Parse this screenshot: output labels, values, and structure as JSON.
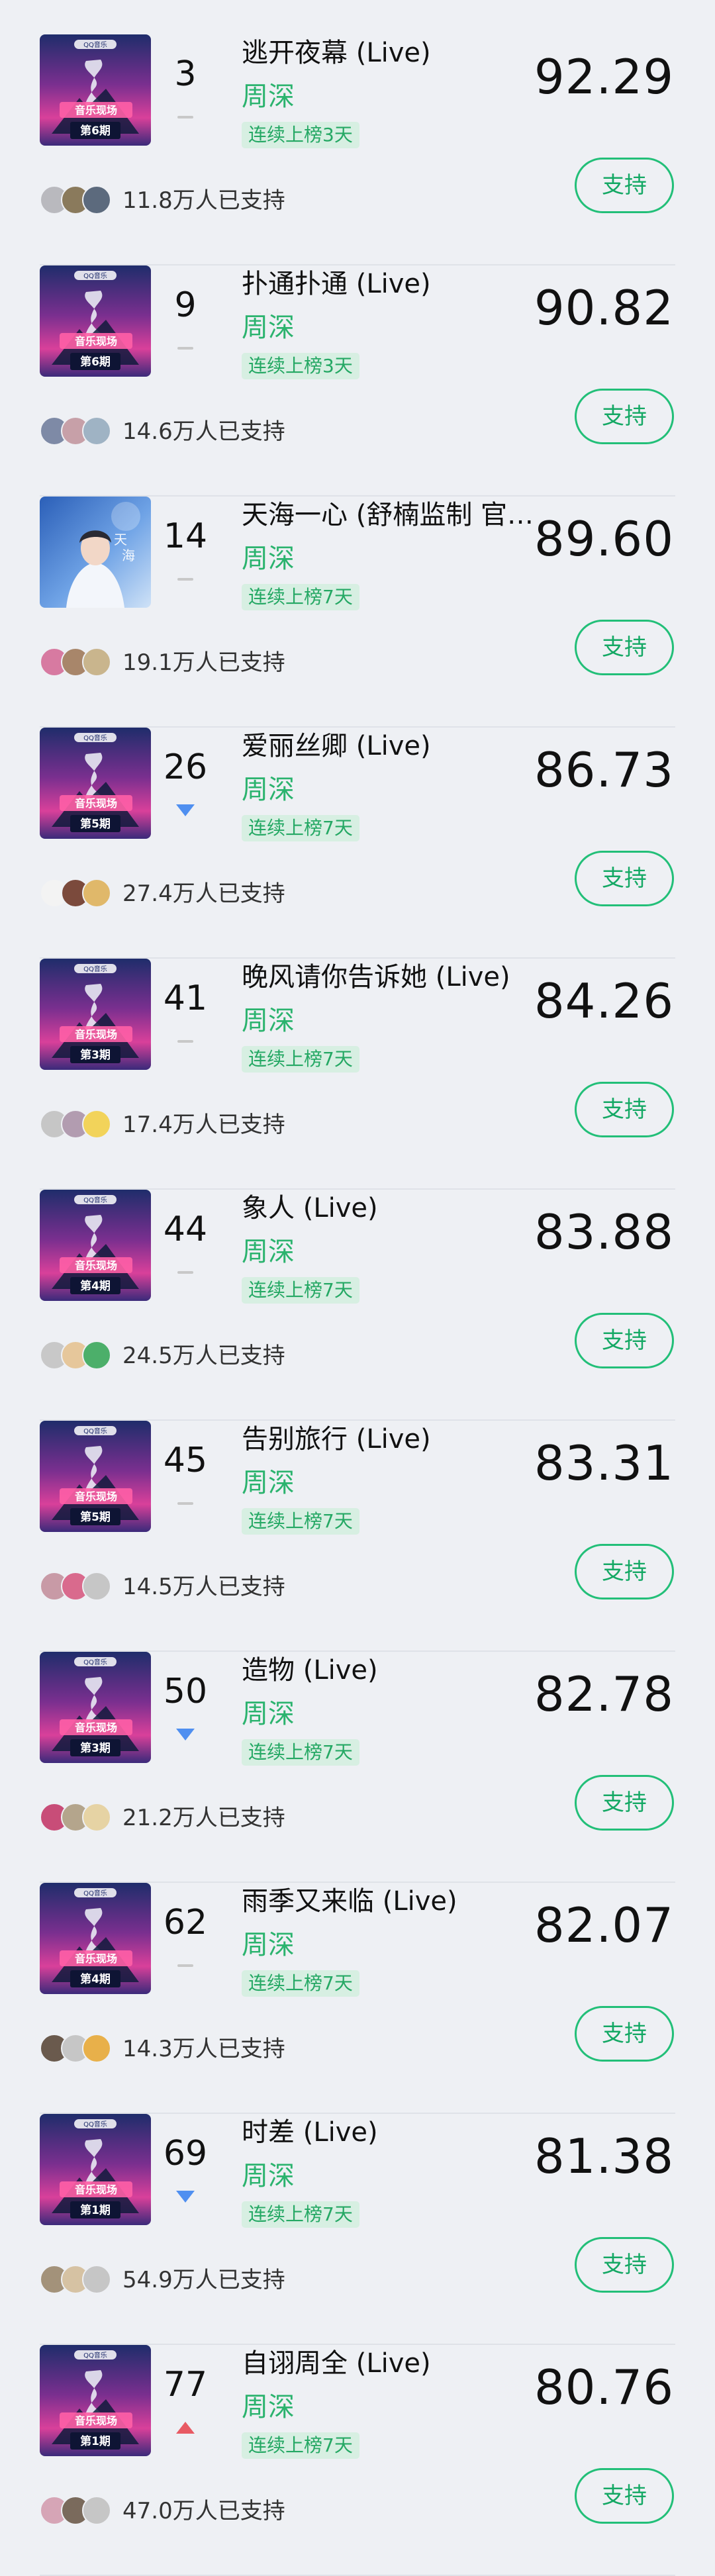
{
  "support_label": "支持",
  "colors": {
    "accent_green": "#22bf78",
    "artist_green": "#2bb36e",
    "badge_bg": "#d7efe2",
    "trend_up": "#e85a63",
    "trend_down": "#4f8ff0",
    "trend_flat": "#c8c8c8"
  },
  "items": [
    {
      "rank": "3",
      "trend": "flat",
      "title": "逃开夜幕 (Live)",
      "artist": "周深",
      "badge": "连续上榜3天",
      "score": "92.29",
      "supporters": "11.8万人已支持",
      "cover_icon": "album-cover-show-ep6",
      "cover_label": "第6期",
      "cover_style": "show"
    },
    {
      "rank": "9",
      "trend": "flat",
      "title": "扑通扑通 (Live)",
      "artist": "周深",
      "badge": "连续上榜3天",
      "score": "90.82",
      "supporters": "14.6万人已支持",
      "cover_icon": "album-cover-show-ep6",
      "cover_label": "第6期",
      "cover_style": "show"
    },
    {
      "rank": "14",
      "trend": "flat",
      "title": "天海一心 (舒楠监制 官方版)",
      "artist": "周深",
      "badge": "连续上榜7天",
      "score": "89.60",
      "supporters": "19.1万人已支持",
      "cover_icon": "album-cover-portrait",
      "cover_label": "",
      "cover_style": "portrait"
    },
    {
      "rank": "26",
      "trend": "down",
      "title": "爱丽丝卿 (Live)",
      "artist": "周深",
      "badge": "连续上榜7天",
      "score": "86.73",
      "supporters": "27.4万人已支持",
      "cover_icon": "album-cover-show-ep5",
      "cover_label": "第5期",
      "cover_style": "show"
    },
    {
      "rank": "41",
      "trend": "flat",
      "title": "晚风请你告诉她 (Live)",
      "artist": "周深",
      "badge": "连续上榜7天",
      "score": "84.26",
      "supporters": "17.4万人已支持",
      "cover_icon": "album-cover-show-ep3",
      "cover_label": "第3期",
      "cover_style": "show"
    },
    {
      "rank": "44",
      "trend": "flat",
      "title": "象人 (Live)",
      "artist": "周深",
      "badge": "连续上榜7天",
      "score": "83.88",
      "supporters": "24.5万人已支持",
      "cover_icon": "album-cover-show-ep4",
      "cover_label": "第4期",
      "cover_style": "show"
    },
    {
      "rank": "45",
      "trend": "flat",
      "title": "告别旅行 (Live)",
      "artist": "周深",
      "badge": "连续上榜7天",
      "score": "83.31",
      "supporters": "14.5万人已支持",
      "cover_icon": "album-cover-show-ep5",
      "cover_label": "第5期",
      "cover_style": "show"
    },
    {
      "rank": "50",
      "trend": "down",
      "title": "造物 (Live)",
      "artist": "周深",
      "badge": "连续上榜7天",
      "score": "82.78",
      "supporters": "21.2万人已支持",
      "cover_icon": "album-cover-show-ep3",
      "cover_label": "第3期",
      "cover_style": "show"
    },
    {
      "rank": "62",
      "trend": "flat",
      "title": "雨季又来临 (Live)",
      "artist": "周深",
      "badge": "连续上榜7天",
      "score": "82.07",
      "supporters": "14.3万人已支持",
      "cover_icon": "album-cover-show-ep4",
      "cover_label": "第4期",
      "cover_style": "show"
    },
    {
      "rank": "69",
      "trend": "down",
      "title": "时差 (Live)",
      "artist": "周深",
      "badge": "连续上榜7天",
      "score": "81.38",
      "supporters": "54.9万人已支持",
      "cover_icon": "album-cover-show-ep1",
      "cover_label": "第1期",
      "cover_style": "show"
    },
    {
      "rank": "77",
      "trend": "up",
      "title": "自诩周全 (Live)",
      "artist": "周深",
      "badge": "连续上榜7天",
      "score": "80.76",
      "supporters": "47.0万人已支持",
      "cover_icon": "album-cover-show-ep1",
      "cover_label": "第1期",
      "cover_style": "show"
    }
  ]
}
